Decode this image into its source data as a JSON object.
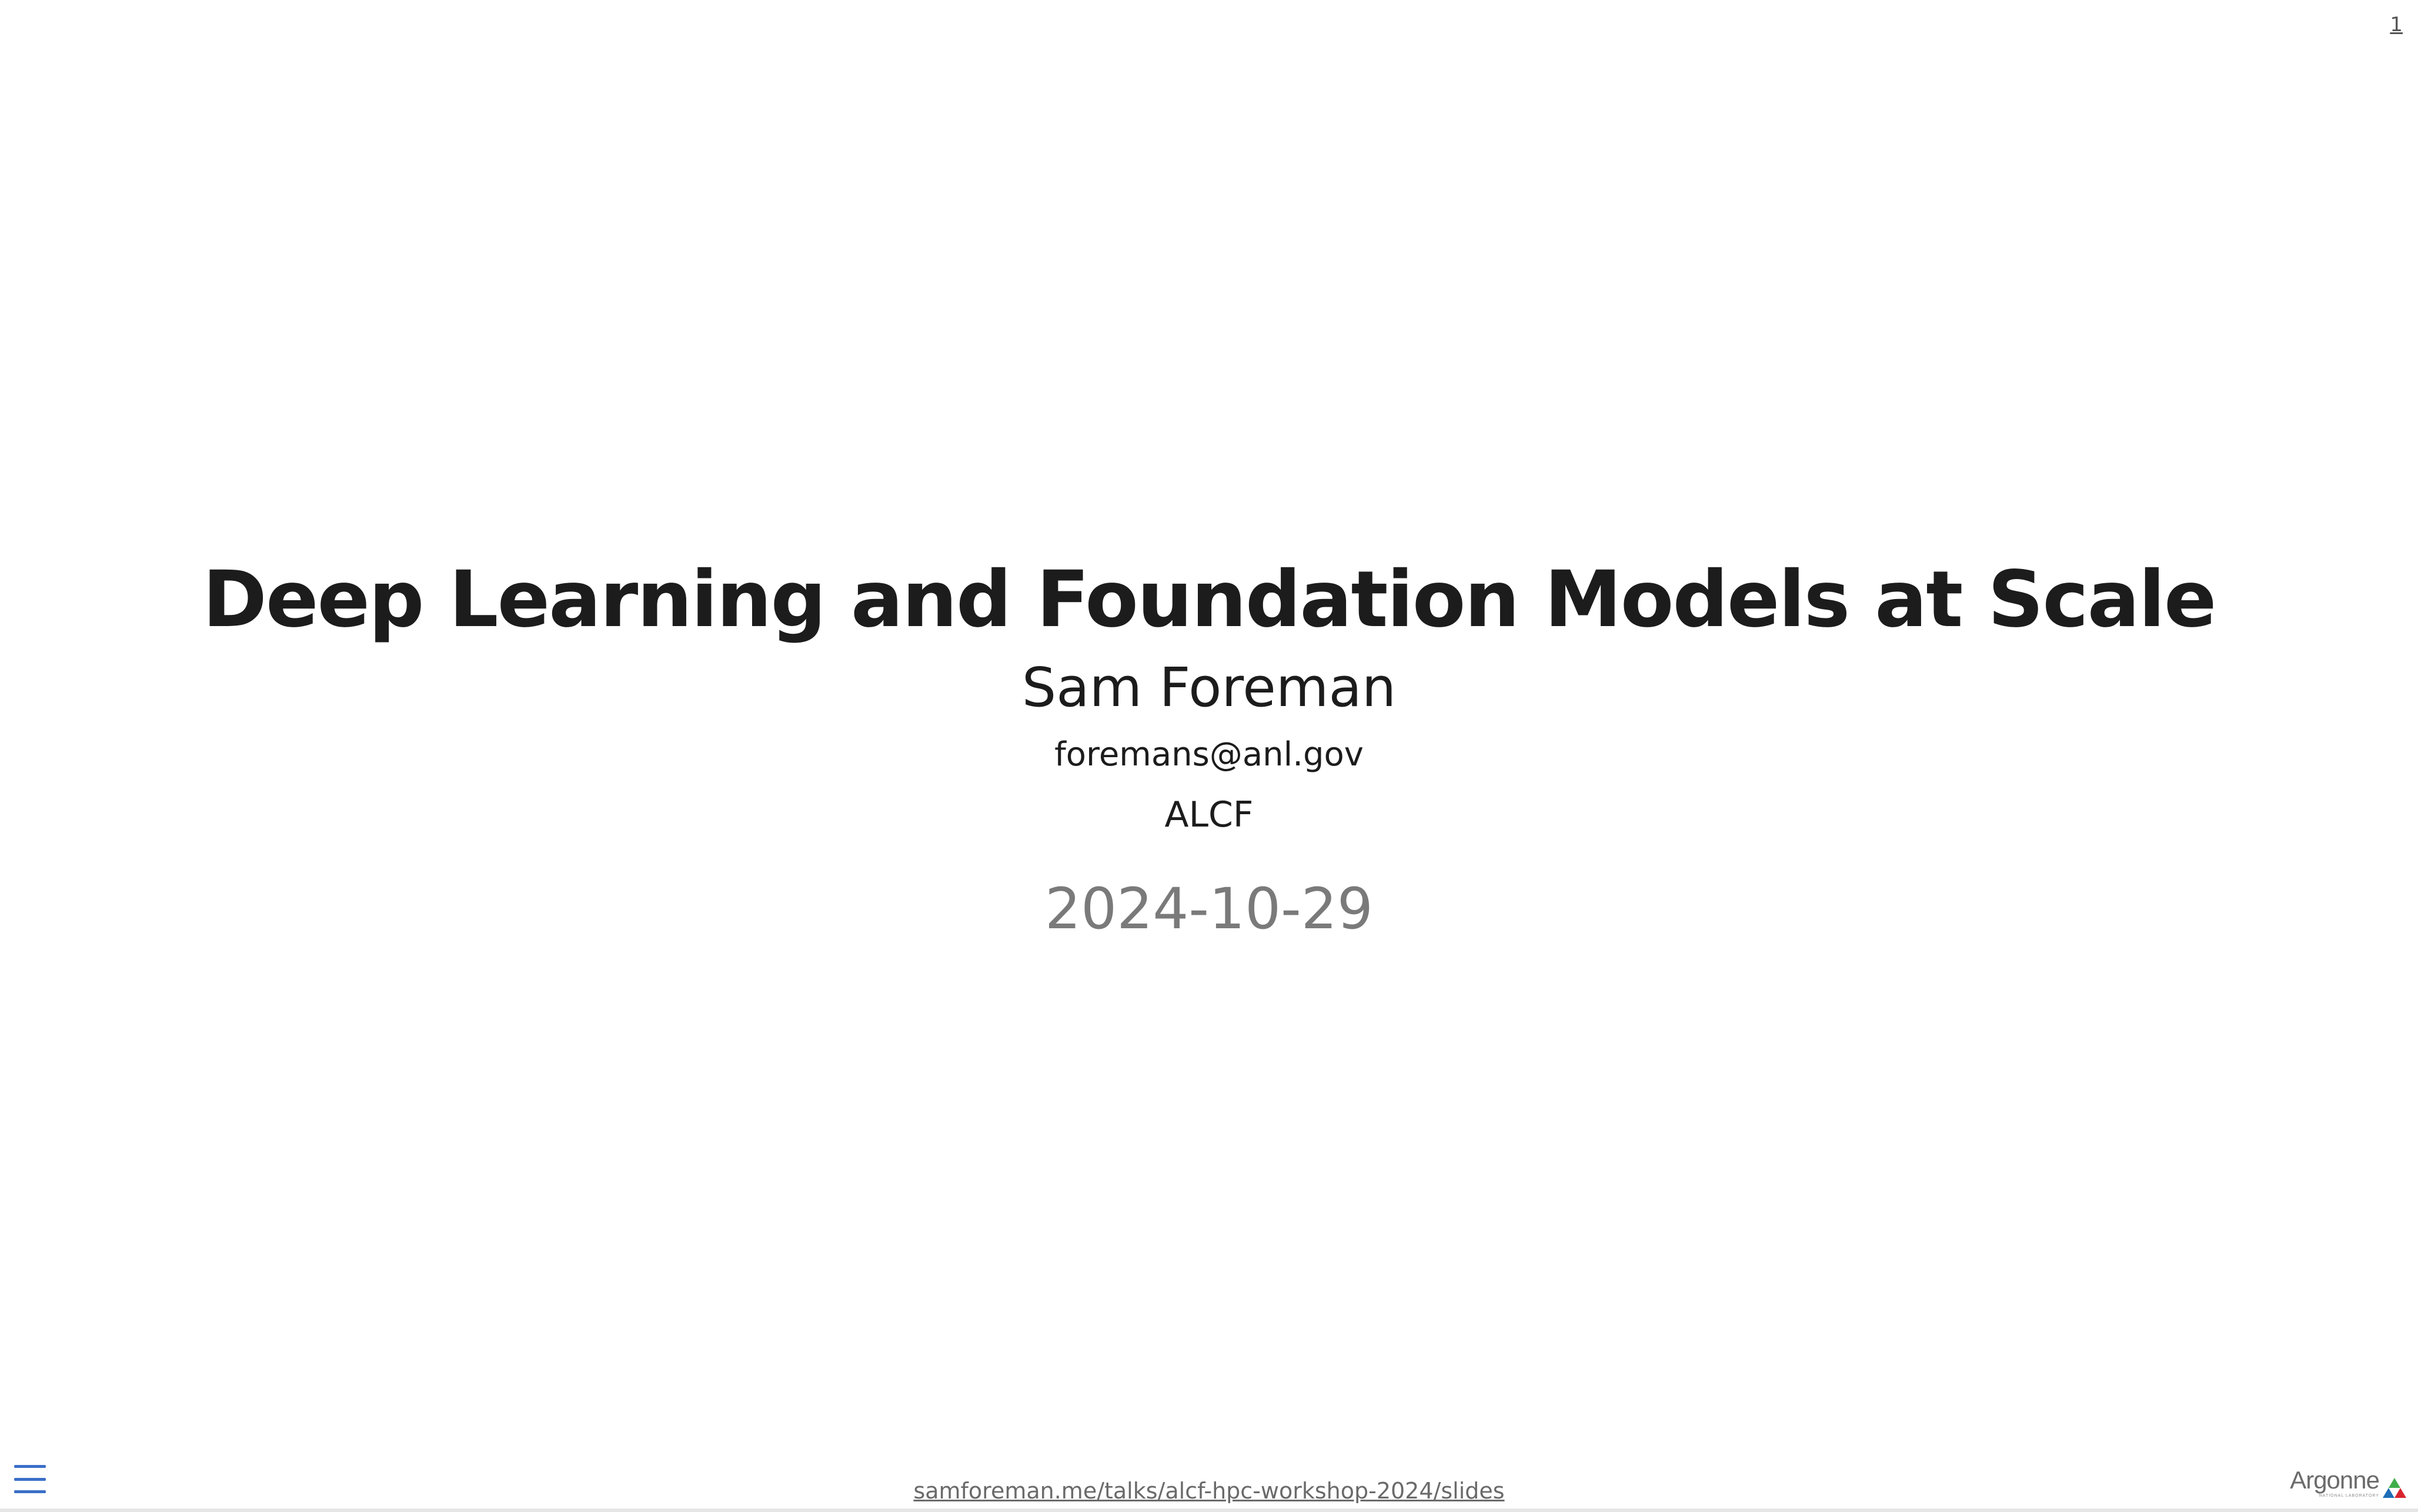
{
  "slide": {
    "number": "1",
    "title": "Deep Learning and Foundation Models at Scale",
    "author": "Sam Foreman",
    "email": "foremans@anl.gov",
    "affiliation": "ALCF",
    "date": "2024-10-29"
  },
  "footer": {
    "url": "samforeman.me/talks/alcf-hpc-workshop-2024/slides",
    "menu_icon": "hamburger-menu-icon",
    "logo": {
      "word": "Argonne",
      "subtitle": "NATIONAL LABORATORY"
    }
  },
  "colors": {
    "title": "#1c1c1c",
    "date": "#7a7a7a",
    "menu_accent": "#3a6fc8",
    "logo_green": "#3fae49",
    "logo_blue": "#1f6fb6",
    "logo_red": "#d9252f"
  }
}
